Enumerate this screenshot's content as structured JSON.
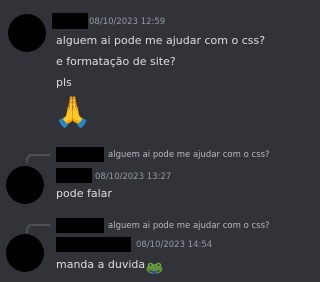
{
  "messages": [
    {
      "timestamp": "08/10/2023 12:59",
      "lines": [
        "alguem ai pode me ajudar com o css?",
        "e formatação de site?",
        "pls"
      ],
      "emoji": "🙏",
      "emoji_name": "folded-hands"
    },
    {
      "reply_preview": "alguem ai pode me ajudar com o css?",
      "timestamp": "08/10/2023 13:27",
      "lines": [
        "pode falar"
      ]
    },
    {
      "reply_preview": "alguem ai pode me ajudar com o css?",
      "timestamp": "08/10/2023 14:54",
      "lines": [
        "manda a duvida"
      ],
      "emoji_name": "frog-emoji"
    }
  ],
  "colors": {
    "background": "#313338",
    "text": "#dbdee1",
    "muted": "#949ba4",
    "redaction": "#000000"
  }
}
